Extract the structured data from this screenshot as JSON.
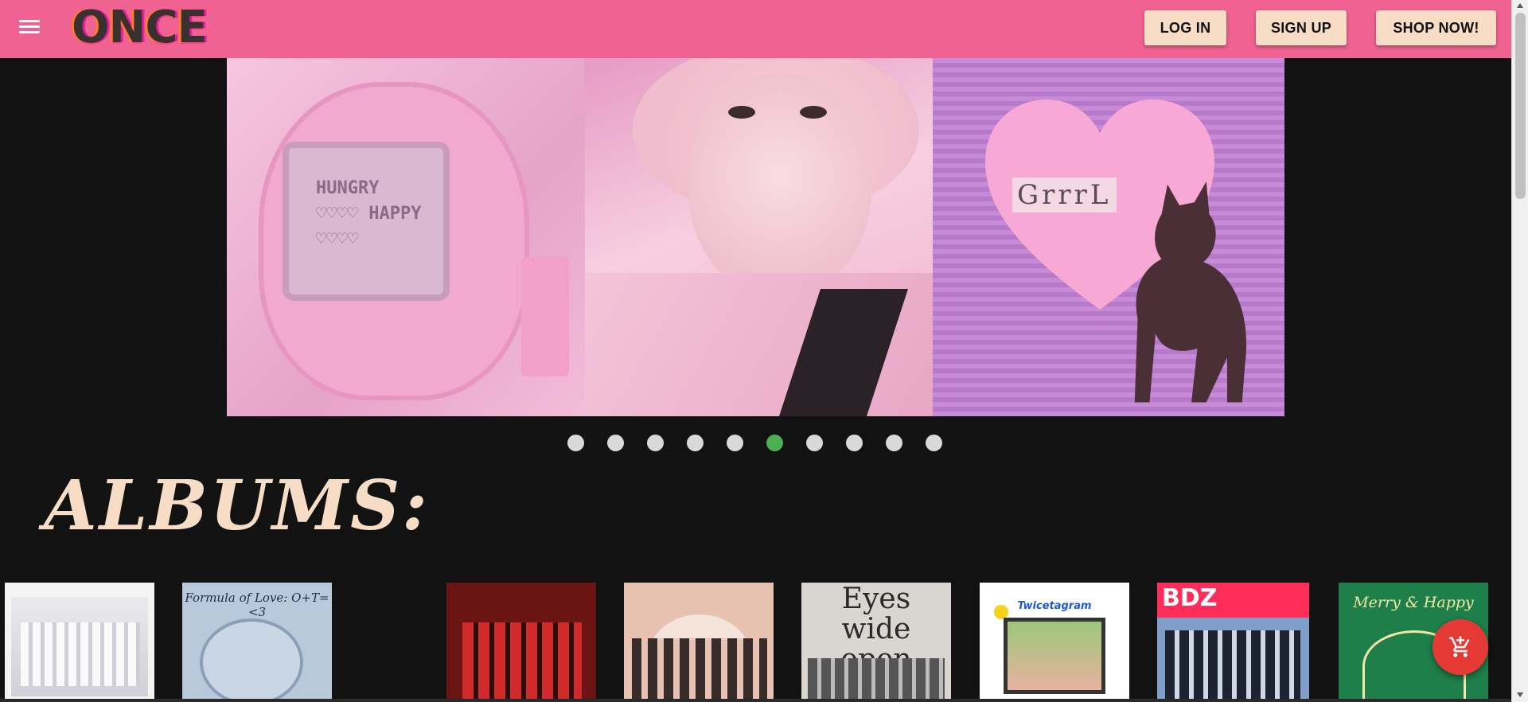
{
  "header": {
    "logo_text": "ONCE",
    "menu_icon": "menu-icon",
    "buttons": {
      "login": "LOG IN",
      "signup": "SIGN UP",
      "shop": "SHOP NOW!"
    },
    "colors": {
      "bar": "#f06292",
      "button": "#f7dcc6"
    }
  },
  "carousel": {
    "slide_texts": {
      "tamagotchi_screen": "HUNGRY ♡♡♡♡ HAPPY ♡♡♡♡",
      "sign": "GrrrL"
    },
    "dot_count": 10,
    "active_dot": 6,
    "colors": {
      "dot": "#d9d9d9",
      "active_dot": "#4caf50"
    }
  },
  "albums": {
    "title": "ALBUMS:",
    "items": [
      {
        "name": "album-white-cover",
        "cover_text": ""
      },
      {
        "name": "album-formula-of-love",
        "cover_text": "Formula of Love: O+T=<3"
      },
      {
        "name": "album-red-cover",
        "cover_text": ""
      },
      {
        "name": "album-peach-cover",
        "cover_text": ""
      },
      {
        "name": "album-eyes-wide-open",
        "cover_text": "Eyes wide open"
      },
      {
        "name": "album-twicetagram",
        "cover_text": "Twicetagram"
      },
      {
        "name": "album-bdz",
        "cover_text": "BDZ"
      },
      {
        "name": "album-merry-and-happy",
        "cover_text": "Merry & Happy"
      }
    ]
  },
  "cart": {
    "icon": "add-shopping-cart-icon",
    "color": "#e53935"
  }
}
